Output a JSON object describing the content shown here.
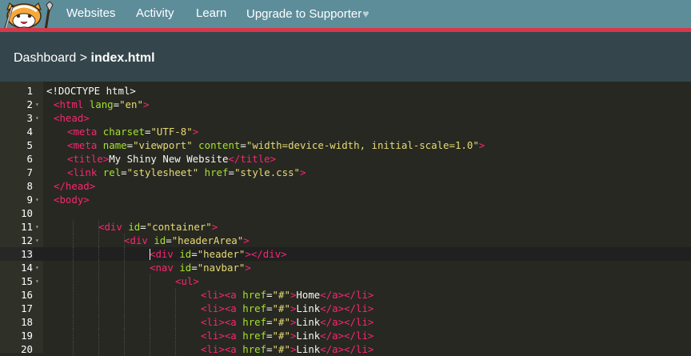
{
  "nav": {
    "links": [
      "Websites",
      "Activity",
      "Learn",
      "Upgrade to Supporter"
    ],
    "heart": "♥"
  },
  "breadcrumb": {
    "root": "Dashboard",
    "separator": ">",
    "file": "index.html"
  },
  "editor": {
    "active_line": 13,
    "colors": {
      "background": "#272822",
      "tag": "#f92672",
      "attribute": "#a6e22e",
      "string": "#e6db74",
      "text": "#f8f8f2"
    },
    "lines": [
      {
        "n": "1",
        "tokens": [
          {
            "c": "p",
            "t": "<!DOCTYPE html>"
          }
        ]
      },
      {
        "n": "2",
        "tokens": [
          {
            "c": "t",
            "t": "<html"
          },
          {
            "c": "p",
            "t": " "
          },
          {
            "c": "a",
            "t": "lang"
          },
          {
            "c": "p",
            "t": "="
          },
          {
            "c": "s",
            "t": "\"en\""
          },
          {
            "c": "t",
            "t": ">"
          }
        ]
      },
      {
        "n": "3",
        "tokens": [
          {
            "c": "t",
            "t": "<head>"
          }
        ]
      },
      {
        "n": "4",
        "tokens": [
          {
            "c": "t",
            "t": "<meta"
          },
          {
            "c": "p",
            "t": " "
          },
          {
            "c": "a",
            "t": "charset"
          },
          {
            "c": "p",
            "t": "="
          },
          {
            "c": "s",
            "t": "\"UTF-8\""
          },
          {
            "c": "t",
            "t": ">"
          }
        ]
      },
      {
        "n": "5",
        "tokens": [
          {
            "c": "t",
            "t": "<meta"
          },
          {
            "c": "p",
            "t": " "
          },
          {
            "c": "a",
            "t": "name"
          },
          {
            "c": "p",
            "t": "="
          },
          {
            "c": "s",
            "t": "\"viewport\""
          },
          {
            "c": "p",
            "t": " "
          },
          {
            "c": "a",
            "t": "content"
          },
          {
            "c": "p",
            "t": "="
          },
          {
            "c": "s",
            "t": "\"width=device-width, initial-scale=1.0\""
          },
          {
            "c": "t",
            "t": ">"
          }
        ]
      },
      {
        "n": "6",
        "tokens": [
          {
            "c": "t",
            "t": "<title>"
          },
          {
            "c": "p",
            "t": "My Shiny New Website"
          },
          {
            "c": "t",
            "t": "</title>"
          }
        ]
      },
      {
        "n": "7",
        "tokens": [
          {
            "c": "t",
            "t": "<link"
          },
          {
            "c": "p",
            "t": " "
          },
          {
            "c": "a",
            "t": "rel"
          },
          {
            "c": "p",
            "t": "="
          },
          {
            "c": "s",
            "t": "\"stylesheet\""
          },
          {
            "c": "p",
            "t": " "
          },
          {
            "c": "a",
            "t": "href"
          },
          {
            "c": "p",
            "t": "="
          },
          {
            "c": "s",
            "t": "\"style.css\""
          },
          {
            "c": "t",
            "t": ">"
          }
        ]
      },
      {
        "n": "8",
        "tokens": [
          {
            "c": "t",
            "t": "</head>"
          }
        ]
      },
      {
        "n": "9",
        "tokens": [
          {
            "c": "t",
            "t": "<body>"
          }
        ]
      },
      {
        "n": "10",
        "tokens": []
      },
      {
        "n": "11",
        "tokens": [
          {
            "c": "t",
            "t": "<div"
          },
          {
            "c": "p",
            "t": " "
          },
          {
            "c": "a",
            "t": "id"
          },
          {
            "c": "p",
            "t": "="
          },
          {
            "c": "s",
            "t": "\"container\""
          },
          {
            "c": "t",
            "t": ">"
          }
        ]
      },
      {
        "n": "12",
        "tokens": [
          {
            "c": "t",
            "t": "<div"
          },
          {
            "c": "p",
            "t": " "
          },
          {
            "c": "a",
            "t": "id"
          },
          {
            "c": "p",
            "t": "="
          },
          {
            "c": "s",
            "t": "\"headerArea\""
          },
          {
            "c": "t",
            "t": ">"
          }
        ]
      },
      {
        "n": "13",
        "tokens": [
          {
            "c": "t",
            "t": "<div"
          },
          {
            "c": "p",
            "t": " "
          },
          {
            "c": "a",
            "t": "id"
          },
          {
            "c": "p",
            "t": "="
          },
          {
            "c": "s",
            "t": "\"header\""
          },
          {
            "c": "t",
            "t": "></div>"
          }
        ]
      },
      {
        "n": "14",
        "tokens": [
          {
            "c": "t",
            "t": "<nav"
          },
          {
            "c": "p",
            "t": " "
          },
          {
            "c": "a",
            "t": "id"
          },
          {
            "c": "p",
            "t": "="
          },
          {
            "c": "s",
            "t": "\"navbar\""
          },
          {
            "c": "t",
            "t": ">"
          }
        ]
      },
      {
        "n": "15",
        "tokens": [
          {
            "c": "t",
            "t": "<ul>"
          }
        ]
      },
      {
        "n": "16",
        "tokens": [
          {
            "c": "t",
            "t": "<li><a"
          },
          {
            "c": "p",
            "t": " "
          },
          {
            "c": "a",
            "t": "href"
          },
          {
            "c": "p",
            "t": "="
          },
          {
            "c": "s",
            "t": "\"#\""
          },
          {
            "c": "t",
            "t": ">"
          },
          {
            "c": "p",
            "t": "Home"
          },
          {
            "c": "t",
            "t": "</a></li>"
          }
        ]
      },
      {
        "n": "17",
        "tokens": [
          {
            "c": "t",
            "t": "<li><a"
          },
          {
            "c": "p",
            "t": " "
          },
          {
            "c": "a",
            "t": "href"
          },
          {
            "c": "p",
            "t": "="
          },
          {
            "c": "s",
            "t": "\"#\""
          },
          {
            "c": "t",
            "t": ">"
          },
          {
            "c": "p",
            "t": "Link"
          },
          {
            "c": "t",
            "t": "</a></li>"
          }
        ]
      },
      {
        "n": "18",
        "tokens": [
          {
            "c": "t",
            "t": "<li><a"
          },
          {
            "c": "p",
            "t": " "
          },
          {
            "c": "a",
            "t": "href"
          },
          {
            "c": "p",
            "t": "="
          },
          {
            "c": "s",
            "t": "\"#\""
          },
          {
            "c": "t",
            "t": ">"
          },
          {
            "c": "p",
            "t": "Link"
          },
          {
            "c": "t",
            "t": "</a></li>"
          }
        ]
      },
      {
        "n": "19",
        "tokens": [
          {
            "c": "t",
            "t": "<li><a"
          },
          {
            "c": "p",
            "t": " "
          },
          {
            "c": "a",
            "t": "href"
          },
          {
            "c": "p",
            "t": "="
          },
          {
            "c": "s",
            "t": "\"#\""
          },
          {
            "c": "t",
            "t": ">"
          },
          {
            "c": "p",
            "t": "Link"
          },
          {
            "c": "t",
            "t": "</a></li>"
          }
        ]
      },
      {
        "n": "20",
        "tokens": [
          {
            "c": "t",
            "t": "<li><a"
          },
          {
            "c": "p",
            "t": " "
          },
          {
            "c": "a",
            "t": "href"
          },
          {
            "c": "p",
            "t": "="
          },
          {
            "c": "s",
            "t": "\"#\""
          },
          {
            "c": "t",
            "t": ">"
          },
          {
            "c": "p",
            "t": "Link"
          },
          {
            "c": "t",
            "t": "</a></li>"
          }
        ]
      }
    ]
  }
}
